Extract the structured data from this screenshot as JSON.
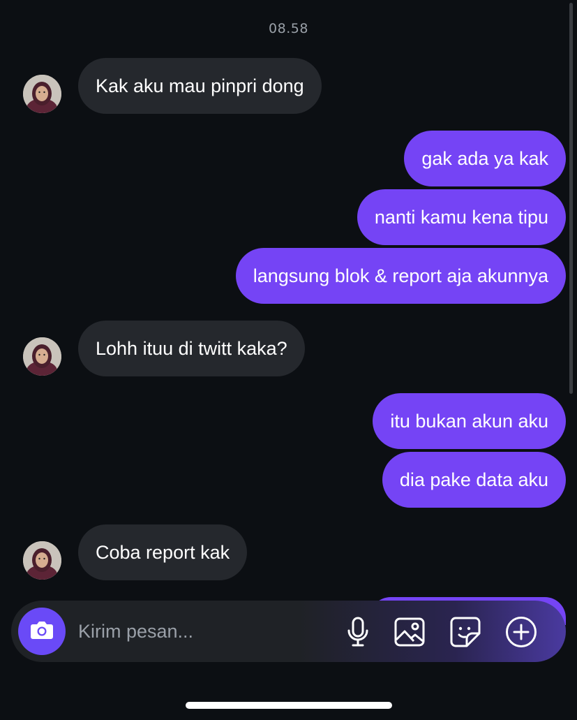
{
  "chat": {
    "timestamp": "08.58",
    "messages": [
      {
        "from": "them",
        "text": "Kak aku mau pinpri dong"
      },
      {
        "from": "me",
        "text": "gak ada ya kak"
      },
      {
        "from": "me",
        "text": "nanti kamu kena tipu"
      },
      {
        "from": "me",
        "text": "langsung blok & report aja akunnya"
      },
      {
        "from": "them",
        "text": "Lohh ituu di twitt kaka?"
      },
      {
        "from": "me",
        "text": "itu bukan akun aku"
      },
      {
        "from": "me",
        "text": "dia pake data aku"
      },
      {
        "from": "them",
        "text": "Coba report kak"
      }
    ]
  },
  "composer": {
    "placeholder": "Kirim pesan...",
    "icons": [
      "camera-icon",
      "microphone-icon",
      "image-icon",
      "sticker-icon",
      "plus-icon"
    ]
  },
  "colors": {
    "background": "#0c0f13",
    "incoming_bubble": "#25282d",
    "outgoing_bubble": "#7544f5",
    "camera_button": "#6a4af7"
  }
}
